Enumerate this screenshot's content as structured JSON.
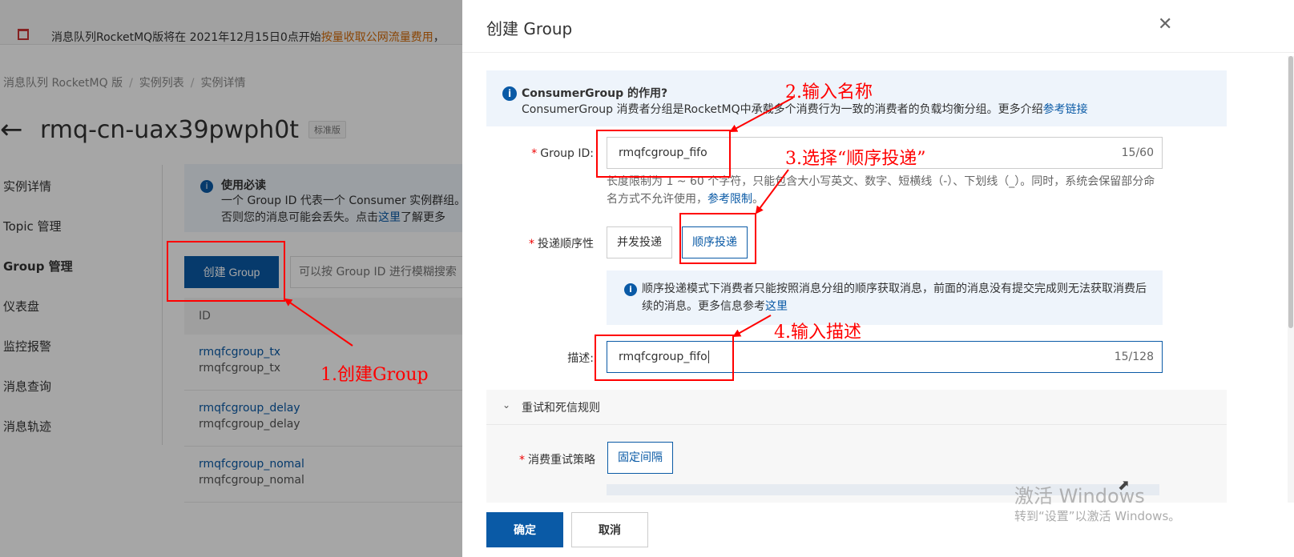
{
  "notice": {
    "text": "消息队列RocketMQ版将在 2021年12月15日0点开始",
    "link": "按量收取公网流量费用",
    "tail": "，"
  },
  "breadcrumb": [
    "消息队列 RocketMQ 版",
    "实例列表",
    "实例详情"
  ],
  "page": {
    "back_icon": "←",
    "instance_id": "rmq-cn-uax39pwph0t",
    "edition": "标准版"
  },
  "sidebar": {
    "items": [
      {
        "label": "实例详情",
        "active": false
      },
      {
        "label": "Topic 管理",
        "active": false
      },
      {
        "label": "Group 管理",
        "active": true
      },
      {
        "label": "仪表盘",
        "active": false
      },
      {
        "label": "监控报警",
        "active": false
      },
      {
        "label": "消息查询",
        "active": false
      },
      {
        "label": "消息轨迹",
        "active": false
      }
    ]
  },
  "usage_tip": {
    "icon": "i",
    "title": "使用必读",
    "line1": "一个 Group ID 代表一个 Consumer 实例群组。",
    "line2": "否则您的消息可能会丢失。点击",
    "link": "这里",
    "line2_tail": "了解更多"
  },
  "toolbar": {
    "create_label": "创建 Group",
    "search_placeholder": "可以按 Group ID 进行模糊搜索"
  },
  "table": {
    "id_header": "ID",
    "rows": [
      {
        "id": "rmqfcgroup_tx",
        "desc": "rmqfcgroup_tx"
      },
      {
        "id": "rmqfcgroup_delay",
        "desc": "rmqfcgroup_delay"
      },
      {
        "id": "rmqfcgroup_nomal",
        "desc": "rmqfcgroup_nomal"
      }
    ]
  },
  "drawer": {
    "title": "创建 Group",
    "close_icon": "✕",
    "info": {
      "icon": "i",
      "title": "ConsumerGroup 的作用?",
      "text": "ConsumerGroup 消费者分组是RocketMQ中承载多个消费行为一致的消费者的负载均衡分组。更多介绍",
      "link": "参考链接"
    },
    "group_id": {
      "label": "Group ID:",
      "value": "rmqfcgroup_fifo",
      "count": "15/60"
    },
    "hint": {
      "text": "长度限制为 1 ~ 60 个字符，只能包含大小写英文、数字、短横线（-）、下划线（_）。同时，系统会保留部分命名方式不允许使用，",
      "link": "参考限制",
      "tail": "。"
    },
    "delivery": {
      "label": "投递顺序性",
      "options": [
        "并发投递",
        "顺序投递"
      ],
      "selected": "顺序投递"
    },
    "order_tip": {
      "icon": "i",
      "text": "顺序投递模式下消费者只能按照消息分组的顺序获取消息，前面的消息没有提交完成则无法获取消费后续的消息。更多信息参考",
      "link": "这里"
    },
    "description": {
      "label": "描述:",
      "value": "rmqfcgroup_fifo",
      "count": "15/128"
    },
    "retry": {
      "chevron_icon": "chevron-down",
      "title": "重试和死信规则",
      "policy_label": "消费重试策略",
      "policy_value": "固定间隔"
    },
    "footer": {
      "ok": "确定",
      "cancel": "取消"
    }
  },
  "annotations": {
    "step1": "1.创建Group",
    "step2": "2.输入名称",
    "step3": "3.选择“顺序投递”",
    "step4": "4.输入描述",
    "color": "#ff0000"
  },
  "watermark": {
    "line1": "激活 Windows",
    "line2": "转到“设置”以激活 Windows。"
  },
  "colors": {
    "primary": "#0a5aa6",
    "info_bg": "#eef4fb",
    "annotation": "#ff0000"
  }
}
